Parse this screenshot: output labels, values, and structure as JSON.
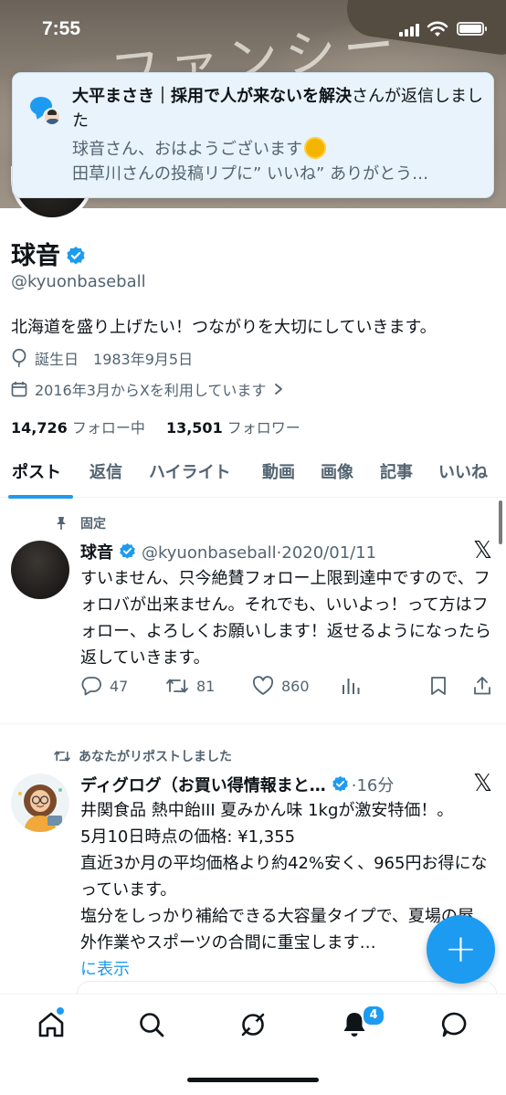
{
  "status_bar": {
    "time": "7:55"
  },
  "notification": {
    "title_name": "大平まさき｜採用で人が来ないを解決",
    "title_suffix": "さんが返信しました",
    "line1": "球音さん、おはようございます",
    "line2": "田草川さんの投稿リプに” いいね” ありがとう…"
  },
  "profile": {
    "name": "球音",
    "handle": "@kyuonbaseball",
    "bio": "北海道を盛り上げたい！つながりを大切にしていきます。",
    "birthday_label": "誕生日",
    "birthday": "1983年9月5日",
    "joined": "2016年3月からXを利用しています",
    "following_count": "14,726",
    "following_label": "フォロー中",
    "followers_count": "13,501",
    "followers_label": "フォロワー"
  },
  "tabs": [
    "ポスト",
    "返信",
    "ハイライト",
    "動画",
    "画像",
    "記事",
    "いいね"
  ],
  "posts": [
    {
      "context": "固定",
      "name": "球音",
      "handle": "@kyuonbaseball",
      "date": "2020/01/11",
      "text": "すいません、只今絶賛フォロー上限到達中ですので、フォロバが出来ません。それでも、いいよっ！って方はフォロー、よろしくお願いします！返せるようになったら返していきます。",
      "replies": "47",
      "reposts": "81",
      "likes": "860"
    },
    {
      "context": "あなたがリポストしました",
      "name": "ディグログ（お買い得情報まと…",
      "time": "16分",
      "text_lines": [
        "井関食品 熱中飴III 夏みかん味 1kgが激安特価！。",
        "5月10日時点の価格: ¥1,355",
        "直近3か月の平均価格より約42%安く、965円お得になっています。",
        "塩分をしっかり補給できる大容量タイプで、夏場の屋外作業やスポーツの合間に重宝します…"
      ],
      "show_more": "に表示"
    }
  ],
  "bottom_nav": {
    "notification_badge": "4"
  },
  "colors": {
    "accent": "#1d9bf0",
    "text": "#0f1419",
    "muted": "#536471"
  }
}
